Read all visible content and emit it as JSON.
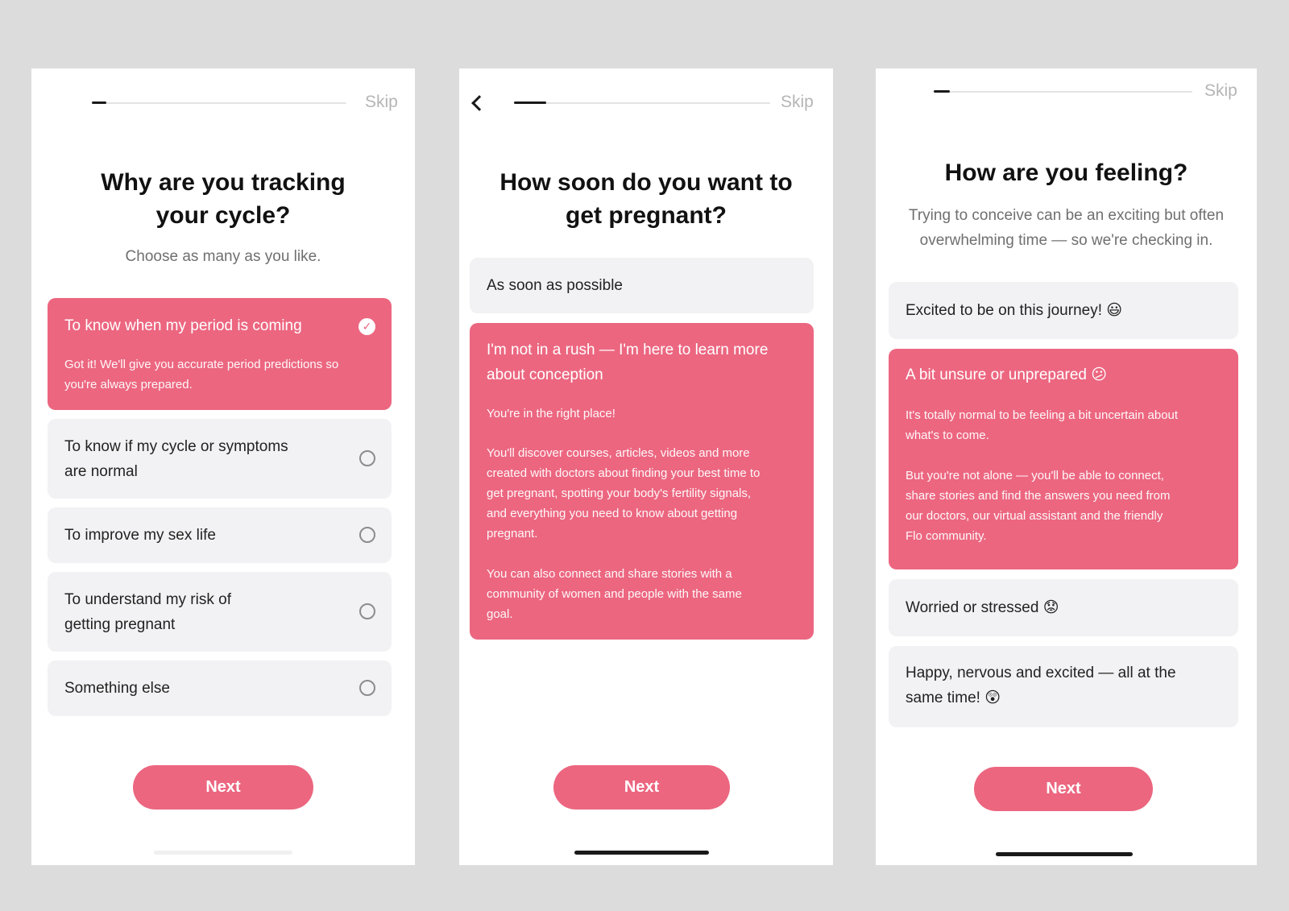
{
  "screen1": {
    "skip_label": "Skip",
    "title_line1": "Why are you tracking",
    "title_line2": "your cycle?",
    "subtitle": "Choose as many as you like.",
    "options": [
      {
        "label": "To know when my period is coming",
        "detail_line1": "Got it! We'll give you accurate period predictions so",
        "detail_line2": "you're always prepared.",
        "selected": true
      },
      {
        "label_line1": "To know if my cycle or symptoms",
        "label_line2": "are normal",
        "selected": false
      },
      {
        "label": "To improve my sex life",
        "selected": false
      },
      {
        "label_line1": "To understand my risk of",
        "label_line2": "getting pregnant",
        "selected": false
      },
      {
        "label": "Something else",
        "selected": false
      }
    ],
    "next_label": "Next"
  },
  "screen2": {
    "skip_label": "Skip",
    "title_line1": "How soon do you want to",
    "title_line2": "get pregnant?",
    "options": [
      {
        "label": "As soon as possible",
        "selected": false
      },
      {
        "label_line1": "I'm not in a rush — I'm here to learn more",
        "label_line2": "about conception",
        "selected": true,
        "detail_p1": "You're in the right place!",
        "detail_p2_lines": [
          "You'll discover courses, articles, videos and more",
          "created with doctors about finding your best time to",
          "get pregnant, spotting your body's fertility signals,",
          "and everything you need to know about getting",
          "pregnant."
        ],
        "detail_p3_lines": [
          "You can also connect and share stories with a",
          "community of women and people with the same",
          "goal."
        ]
      }
    ],
    "next_label": "Next"
  },
  "screen3": {
    "skip_label": "Skip",
    "title": "How are you feeling?",
    "subtitle_line1": "Trying to conceive can be an exciting but often",
    "subtitle_line2": "overwhelming time — so we're checking in.",
    "options": [
      {
        "label": "Excited to be on this journey! 😃",
        "selected": false
      },
      {
        "label": "A bit unsure or unprepared 😕",
        "selected": true,
        "detail_p1_lines": [
          "It's totally normal to be feeling a bit uncertain about",
          "what's to come."
        ],
        "detail_p2_lines": [
          "But you're not alone — you'll be able to connect,",
          "share stories and find the answers you need from",
          "our doctors, our virtual assistant and the friendly",
          "Flo community."
        ]
      },
      {
        "label": "Worried or stressed 😟",
        "selected": false
      },
      {
        "label_line1": "Happy, nervous and excited — all at the",
        "label_line2": "same time! 😲",
        "selected": false
      }
    ],
    "next_label": "Next"
  },
  "colors": {
    "accent": "#ec6680",
    "option_bg": "#f2f2f4",
    "page_bg": "#dcdcdc"
  },
  "icons": {
    "back": "chevron-left-icon",
    "checked": "check-circle-icon",
    "unchecked": "radio-empty-icon"
  }
}
